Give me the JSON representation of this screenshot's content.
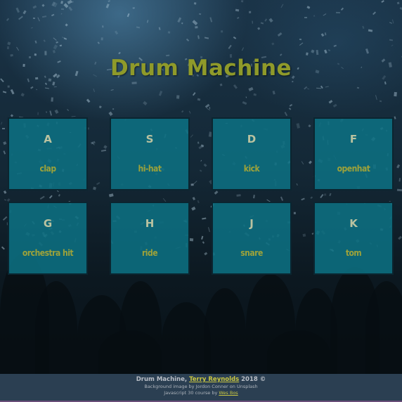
{
  "header": {
    "title": "Drum Machine"
  },
  "pads": [
    {
      "key": "A",
      "sound": "clap"
    },
    {
      "key": "S",
      "sound": "hi-hat"
    },
    {
      "key": "D",
      "sound": "kick"
    },
    {
      "key": "F",
      "sound": "openhat"
    },
    {
      "key": "G",
      "sound": "orchestra hit"
    },
    {
      "key": "H",
      "sound": "ride"
    },
    {
      "key": "J",
      "sound": "snare"
    },
    {
      "key": "K",
      "sound": "tom"
    }
  ],
  "footer": {
    "line1_prefix": "Drum Machine, ",
    "author_link": "Terry Reynolds",
    "line1_suffix": " 2018 ©",
    "line2": "Background image by Jordon Conner on Unsplash",
    "line3_prefix": "Javascript 30 course by ",
    "course_link": "Wes Bos"
  },
  "colors": {
    "title": "#8f9a2a",
    "pad_fill": "#0d7082",
    "pad_key": "#b9c2a0",
    "pad_sound": "#9da23a",
    "footer_bg": "#2b3f52",
    "link": "#c9c642"
  }
}
